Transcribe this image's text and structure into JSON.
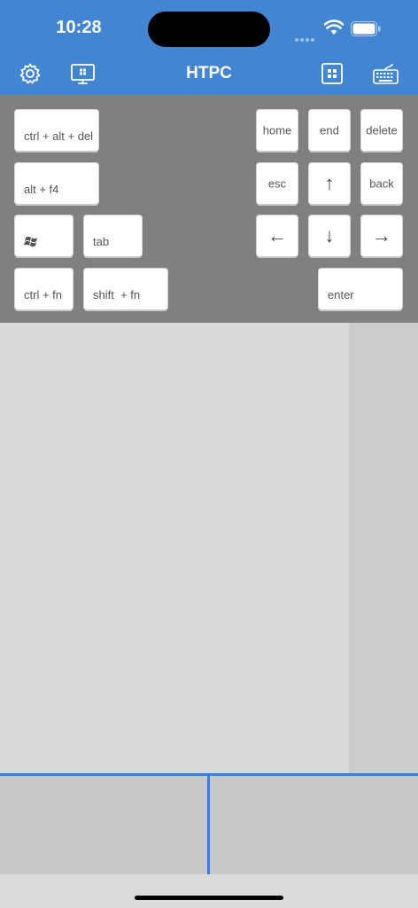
{
  "status_bar": {
    "time": "10:28"
  },
  "nav": {
    "title": "HTPC",
    "icons": [
      "gear-icon",
      "monitor-icon",
      "grid-icon",
      "keyboard-icon"
    ]
  },
  "keys": {
    "ctrl_alt_del": "ctrl + alt + del",
    "alt_f4": "alt + f4",
    "windows": "windows-logo-icon",
    "tab": "tab",
    "ctrl_fn": "ctrl + fn",
    "shift_fn": "shift  + fn",
    "home": "home",
    "end": "end",
    "delete": "delete",
    "esc": "esc",
    "up": "↑",
    "back": "back",
    "left": "←",
    "down": "↓",
    "right": "→",
    "enter": "enter"
  },
  "colors": {
    "header": "#4285d3",
    "key_panel": "#808080",
    "accent_line": "#3c7ed4"
  }
}
